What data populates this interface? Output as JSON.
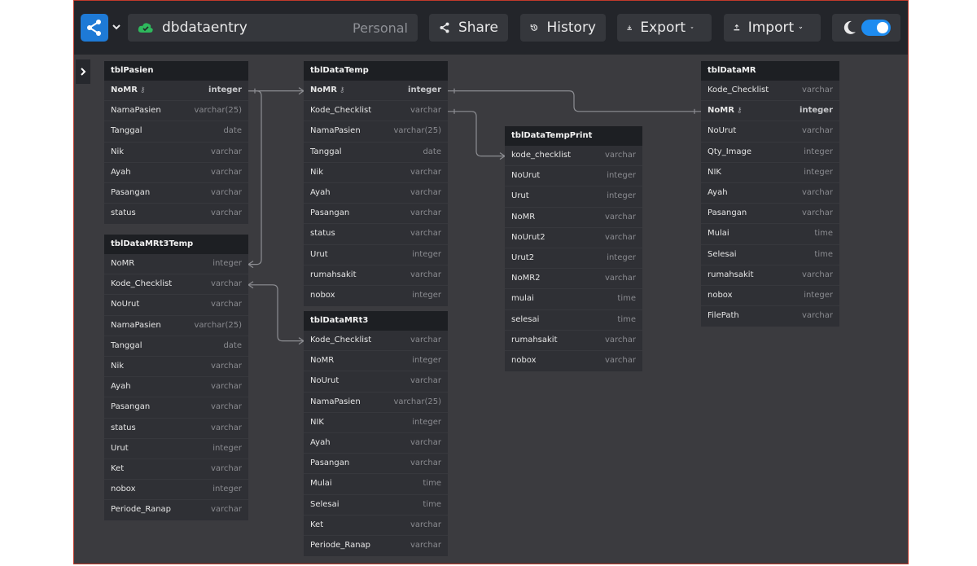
{
  "toolbar": {
    "project_name": "dbdataentry",
    "project_scope": "Personal",
    "share_label": "Share",
    "history_label": "History",
    "export_label": "Export",
    "import_label": "Import",
    "accent_color": "#1e7ad6",
    "toggle_color": "#1e8cf0"
  },
  "tables": [
    {
      "name": "tblPasien",
      "fields": [
        {
          "name": "NoMR",
          "type": "integer",
          "pk": true
        },
        {
          "name": "NamaPasien",
          "type": "varchar(25)"
        },
        {
          "name": "Tanggal",
          "type": "date"
        },
        {
          "name": "Nik",
          "type": "varchar"
        },
        {
          "name": "Ayah",
          "type": "varchar"
        },
        {
          "name": "Pasangan",
          "type": "varchar"
        },
        {
          "name": "status",
          "type": "varchar"
        }
      ]
    },
    {
      "name": "tblDataMRt3Temp",
      "fields": [
        {
          "name": "NoMR",
          "type": "integer"
        },
        {
          "name": "Kode_Checklist",
          "type": "varchar"
        },
        {
          "name": "NoUrut",
          "type": "varchar"
        },
        {
          "name": "NamaPasien",
          "type": "varchar(25)"
        },
        {
          "name": "Tanggal",
          "type": "date"
        },
        {
          "name": "Nik",
          "type": "varchar"
        },
        {
          "name": "Ayah",
          "type": "varchar"
        },
        {
          "name": "Pasangan",
          "type": "varchar"
        },
        {
          "name": "status",
          "type": "varchar"
        },
        {
          "name": "Urut",
          "type": "integer"
        },
        {
          "name": "Ket",
          "type": "varchar"
        },
        {
          "name": "nobox",
          "type": "integer"
        },
        {
          "name": "Periode_Ranap",
          "type": "varchar"
        }
      ]
    },
    {
      "name": "tblDataTemp",
      "fields": [
        {
          "name": "NoMR",
          "type": "integer",
          "pk": true
        },
        {
          "name": "Kode_Checklist",
          "type": "varchar"
        },
        {
          "name": "NamaPasien",
          "type": "varchar(25)"
        },
        {
          "name": "Tanggal",
          "type": "date"
        },
        {
          "name": "Nik",
          "type": "varchar"
        },
        {
          "name": "Ayah",
          "type": "varchar"
        },
        {
          "name": "Pasangan",
          "type": "varchar"
        },
        {
          "name": "status",
          "type": "varchar"
        },
        {
          "name": "Urut",
          "type": "integer"
        },
        {
          "name": "rumahsakit",
          "type": "varchar"
        },
        {
          "name": "nobox",
          "type": "integer"
        }
      ]
    },
    {
      "name": "tblDataMRt3",
      "fields": [
        {
          "name": "Kode_Checklist",
          "type": "varchar"
        },
        {
          "name": "NoMR",
          "type": "integer"
        },
        {
          "name": "NoUrut",
          "type": "varchar"
        },
        {
          "name": "NamaPasien",
          "type": "varchar(25)"
        },
        {
          "name": "NIK",
          "type": "integer"
        },
        {
          "name": "Ayah",
          "type": "varchar"
        },
        {
          "name": "Pasangan",
          "type": "varchar"
        },
        {
          "name": "Mulai",
          "type": "time"
        },
        {
          "name": "Selesai",
          "type": "time"
        },
        {
          "name": "Ket",
          "type": "varchar"
        },
        {
          "name": "Periode_Ranap",
          "type": "varchar"
        }
      ]
    },
    {
      "name": "tblDataTempPrint",
      "fields": [
        {
          "name": "kode_checklist",
          "type": "varchar"
        },
        {
          "name": "NoUrut",
          "type": "integer"
        },
        {
          "name": "Urut",
          "type": "integer"
        },
        {
          "name": "NoMR",
          "type": "varchar"
        },
        {
          "name": "NoUrut2",
          "type": "varchar"
        },
        {
          "name": "Urut2",
          "type": "integer"
        },
        {
          "name": "NoMR2",
          "type": "varchar"
        },
        {
          "name": "mulai",
          "type": "time"
        },
        {
          "name": "selesai",
          "type": "time"
        },
        {
          "name": "rumahsakit",
          "type": "varchar"
        },
        {
          "name": "nobox",
          "type": "varchar"
        }
      ]
    },
    {
      "name": "tblDataMR",
      "fields": [
        {
          "name": "Kode_Checklist",
          "type": "varchar"
        },
        {
          "name": "NoMR",
          "type": "integer",
          "pk": true
        },
        {
          "name": "NoUrut",
          "type": "varchar"
        },
        {
          "name": "Qty_Image",
          "type": "integer"
        },
        {
          "name": "NIK",
          "type": "integer"
        },
        {
          "name": "Ayah",
          "type": "varchar"
        },
        {
          "name": "Pasangan",
          "type": "varchar"
        },
        {
          "name": "Mulai",
          "type": "time"
        },
        {
          "name": "Selesai",
          "type": "time"
        },
        {
          "name": "rumahsakit",
          "type": "varchar"
        },
        {
          "name": "nobox",
          "type": "integer"
        },
        {
          "name": "FilePath",
          "type": "varchar"
        }
      ]
    }
  ],
  "relations": [
    {
      "from": "tblPasien.NoMR",
      "to": "tblDataTemp.NoMR"
    },
    {
      "from": "tblPasien.NoMR",
      "to": "tblDataMRt3Temp.NoMR"
    },
    {
      "from": "tblDataTemp.NoMR",
      "to": "tblDataMR.NoMR"
    },
    {
      "from": "tblDataTemp.Kode_Checklist",
      "to": "tblDataTempPrint.kode_checklist"
    },
    {
      "from": "tblDataMRt3Temp.Kode_Checklist",
      "to": "tblDataMRt3.Kode_Checklist"
    }
  ]
}
